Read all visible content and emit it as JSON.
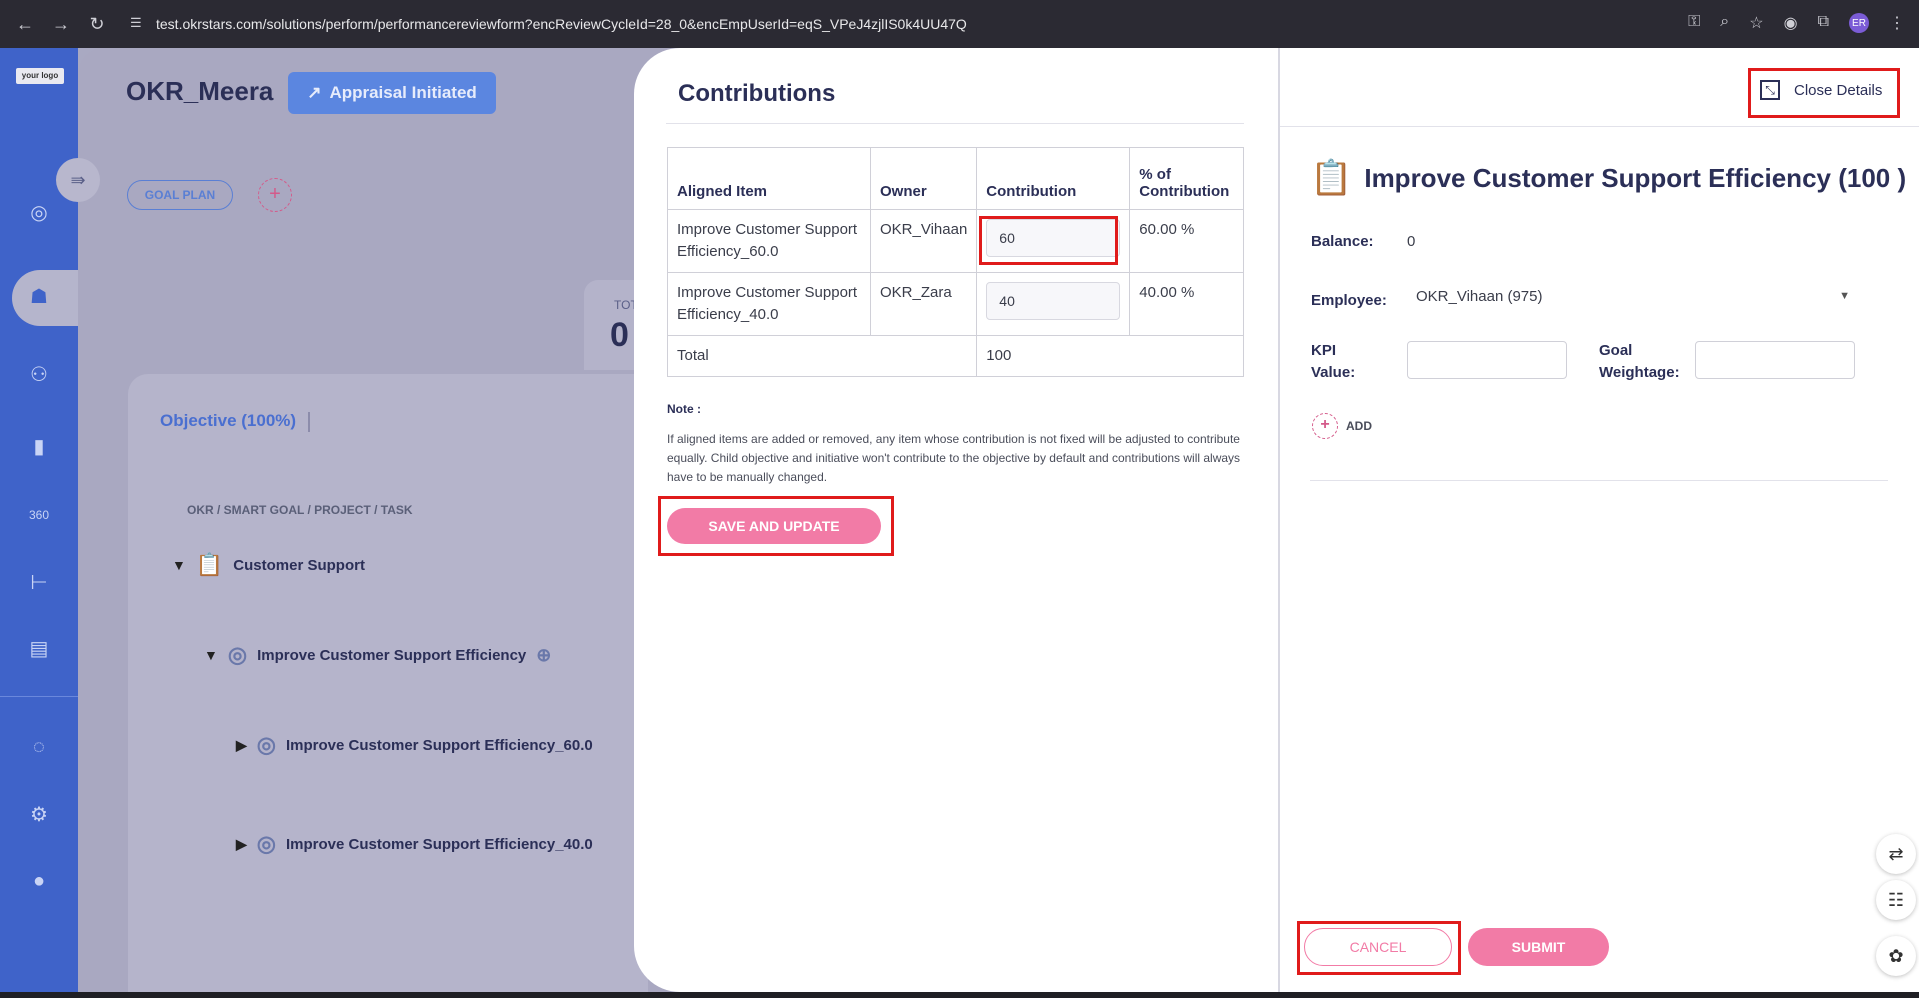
{
  "browser": {
    "url": "test.okrstars.com/solutions/perform/performancereviewform?encReviewCycleId=28_0&encEmpUserId=eqS_VPeJ4zjlIS0k4UU47Q",
    "avatar_text": "ER"
  },
  "sidebar": {
    "logo_text": "your logo"
  },
  "header": {
    "owner": "OKR_Meera",
    "status_button": "Appraisal Initiated",
    "goal_plan": "GOAL PLAN",
    "total_label": "TOT",
    "total_value": "0"
  },
  "objectives": {
    "tab": "Objective (100%)",
    "column_header": "OKR / SMART GOAL / PROJECT / TASK",
    "tree": [
      {
        "label": "Customer Support"
      },
      {
        "label": "Improve Customer Support Efficiency"
      },
      {
        "label": "Improve Customer Support Efficiency_60.0"
      },
      {
        "label": "Improve Customer Support Efficiency_40.0"
      }
    ]
  },
  "contributions": {
    "title": "Contributions",
    "headers": [
      "Aligned Item",
      "Owner",
      "Contribution",
      "% of Contribution"
    ],
    "rows": [
      {
        "item": "Improve Customer Support Efficiency_60.0",
        "owner": "OKR_Vihaan",
        "contribution": "60",
        "percent": "60.00 %"
      },
      {
        "item": "Improve Customer Support Efficiency_40.0",
        "owner": "OKR_Zara",
        "contribution": "40",
        "percent": "40.00 %"
      }
    ],
    "total_label": "Total",
    "total_value": "100",
    "note_heading": "Note :",
    "note_text": "If aligned items are added or removed, any item whose contribution is not fixed will be adjusted to contribute equally. Child objective and initiative won't contribute to the objective by default and contributions will always have to be manually changed.",
    "save_button": "SAVE AND UPDATE"
  },
  "details": {
    "close_label": "Close Details",
    "title": "Improve Customer Support Efficiency (100 )",
    "balance_label": "Balance:",
    "balance_value": "0",
    "employee_label": "Employee:",
    "employee_value": "OKR_Vihaan (975)",
    "kpi_label_1": "KPI",
    "kpi_label_2": "Value:",
    "goal_label_1": "Goal",
    "goal_label_2": "Weightage:",
    "add_label": "ADD",
    "cancel_button": "CANCEL",
    "submit_button": "SUBMIT"
  },
  "colors": {
    "accent_pink": "#f27ba6",
    "primary_blue": "#3f63c9",
    "highlight_red": "#e01b1b"
  }
}
